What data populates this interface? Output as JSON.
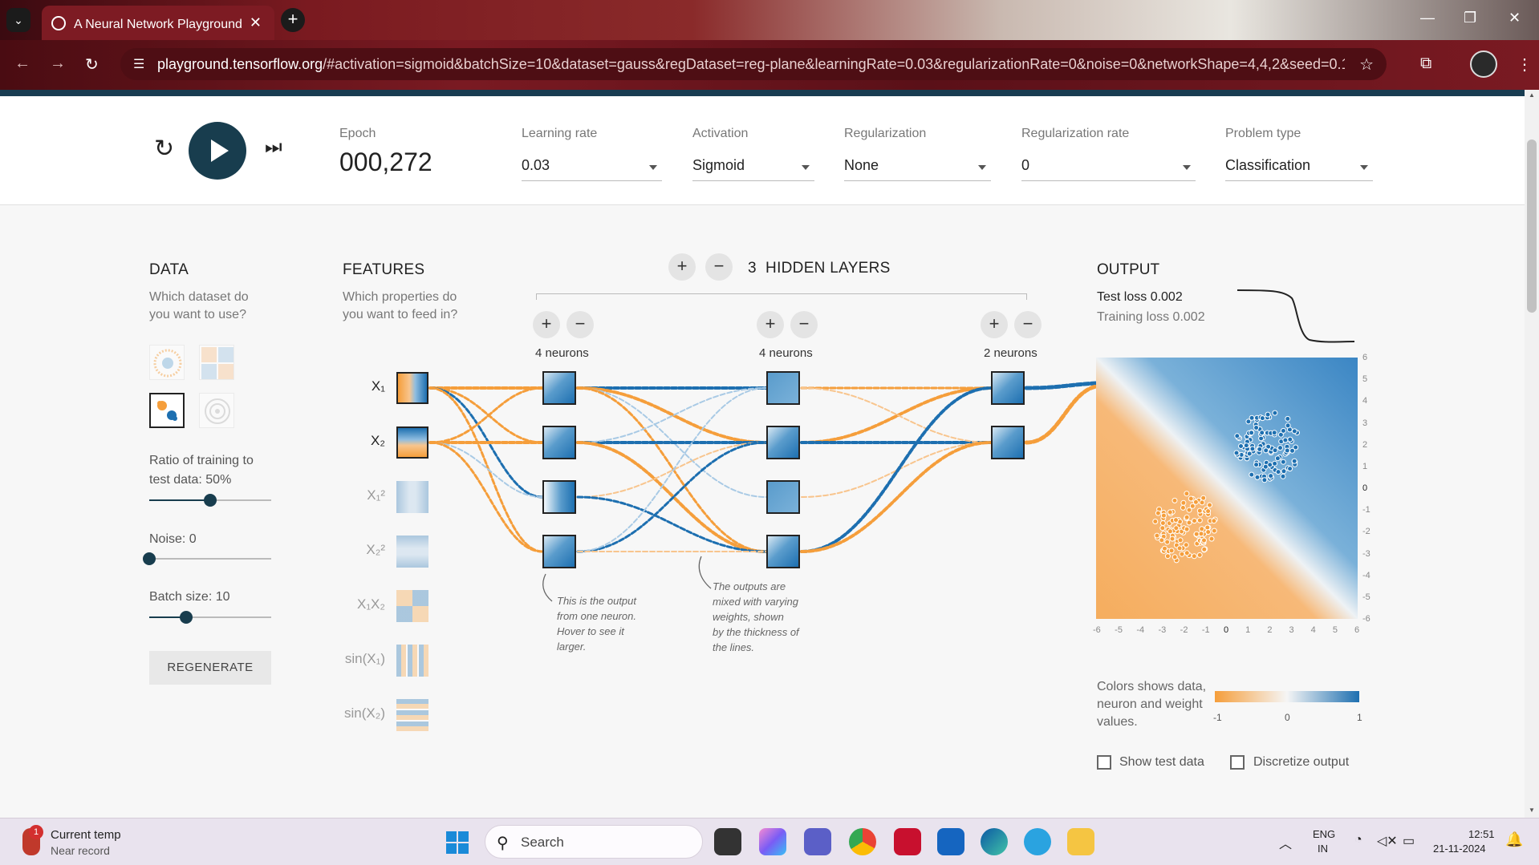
{
  "browser": {
    "tab_title": "A Neural Network Playground",
    "tab_close": "✕",
    "new_tab": "+",
    "url_host": "playground.tensorflow.org",
    "url_path": "/#activation=sigmoid&batchSize=10&dataset=gauss&regDataset=reg-plane&learningRate=0.03&regularizationRate=0&noise=0&networkShape=4,4,2&seed=0.10..."
  },
  "controls": {
    "epoch_label": "Epoch",
    "epoch_value": "000,272",
    "learning_rate_label": "Learning rate",
    "learning_rate_value": "0.03",
    "activation_label": "Activation",
    "activation_value": "Sigmoid",
    "regularization_label": "Regularization",
    "regularization_value": "None",
    "reg_rate_label": "Regularization rate",
    "reg_rate_value": "0",
    "problem_label": "Problem type",
    "problem_value": "Classification"
  },
  "data_panel": {
    "heading": "DATA",
    "sub1": "Which dataset do",
    "sub2": "you want to use?",
    "ratio_label1": "Ratio of training to",
    "ratio_label2": "test data:  50%",
    "ratio_value": 0.5,
    "noise_label": "Noise:  0",
    "noise_value": 0,
    "batch_label": "Batch size:  10",
    "batch_value": 0.3,
    "regenerate": "REGENERATE"
  },
  "features": {
    "heading": "FEATURES",
    "sub1": "Which properties do",
    "sub2": "you want to feed in?",
    "items": [
      {
        "label": "X₁",
        "active": true
      },
      {
        "label": "X₂",
        "active": true
      },
      {
        "label": "X₁²",
        "active": false
      },
      {
        "label": "X₂²",
        "active": false
      },
      {
        "label": "X₁X₂",
        "active": false
      },
      {
        "label": "sin(X₁)",
        "active": false
      },
      {
        "label": "sin(X₂)",
        "active": false
      }
    ]
  },
  "network": {
    "count": "3",
    "title": "HIDDEN LAYERS",
    "add": "+",
    "remove": "−",
    "layers": [
      {
        "label": "4 neurons"
      },
      {
        "label": "4 neurons"
      },
      {
        "label": "2 neurons"
      }
    ],
    "note1": [
      "This is the output",
      "from one neuron.",
      "Hover to see it",
      "larger."
    ],
    "note2": [
      "The outputs are",
      "mixed with varying",
      "weights, shown",
      "by the thickness of",
      "the lines."
    ]
  },
  "output": {
    "heading": "OUTPUT",
    "test_loss": "Test loss 0.002",
    "training_loss": "Training loss 0.002",
    "y_ticks": [
      "6",
      "5",
      "4",
      "3",
      "2",
      "1",
      "0",
      "-1",
      "-2",
      "-3",
      "-4",
      "-5",
      "-6"
    ],
    "x_ticks": [
      "-6",
      "-5",
      "-4",
      "-3",
      "-2",
      "-1",
      "0",
      "1",
      "2",
      "3",
      "4",
      "5",
      "6"
    ],
    "legend_text": "Colors shows data, neuron and weight values.",
    "legend_ticks": [
      "-1",
      "0",
      "1"
    ],
    "show_test": "Show test data",
    "discretize": "Discretize output"
  },
  "colors": {
    "positive": "#1d6fb0",
    "negative": "#f59e3b",
    "dark": "#183d4e"
  },
  "taskbar": {
    "weather_title": "Current temp",
    "weather_sub": "Near record",
    "weather_badge": "1",
    "search": "Search",
    "lang1": "ENG",
    "lang2": "IN",
    "time": "12:51",
    "date": "21-11-2024"
  }
}
